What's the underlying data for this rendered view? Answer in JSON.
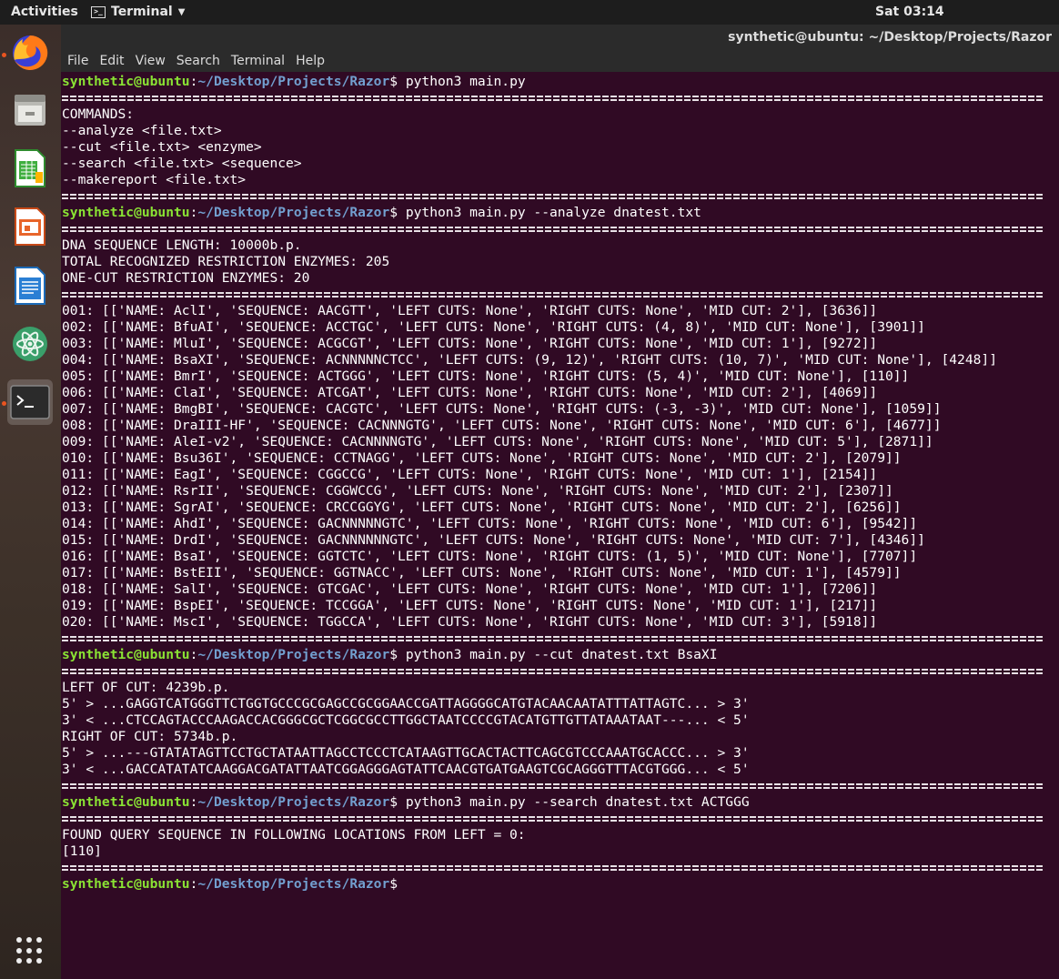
{
  "topbar": {
    "activities": "Activities",
    "app_name": "Terminal",
    "clock": "Sat 03:14"
  },
  "window": {
    "title": "synthetic@ubuntu: ~/Desktop/Projects/Razor"
  },
  "menu": [
    "File",
    "Edit",
    "View",
    "Search",
    "Terminal",
    "Help"
  ],
  "prompt": {
    "user": "synthetic@ubuntu",
    "colon": ":",
    "path": "~/Desktop/Projects/Razor",
    "dollar": "$"
  },
  "dock": {
    "items": [
      "firefox-icon",
      "files-icon",
      "calc-icon",
      "impress-icon",
      "writer-icon",
      "atom-icon",
      "terminal-icon",
      "app-grid-icon"
    ]
  },
  "terminal": {
    "lines": [
      {
        "type": "prompt",
        "cmd": " python3 main.py"
      },
      {
        "type": "sep"
      },
      {
        "type": "out",
        "text": "COMMANDS:"
      },
      {
        "type": "out",
        "text": "--analyze <file.txt>"
      },
      {
        "type": "out",
        "text": "--cut <file.txt> <enzyme>"
      },
      {
        "type": "out",
        "text": "--search <file.txt> <sequence>"
      },
      {
        "type": "out",
        "text": "--makereport <file.txt>"
      },
      {
        "type": "sep"
      },
      {
        "type": "prompt",
        "cmd": " python3 main.py --analyze dnatest.txt"
      },
      {
        "type": "sep"
      },
      {
        "type": "out",
        "text": "DNA SEQUENCE LENGTH: 10000b.p."
      },
      {
        "type": "out",
        "text": "TOTAL RECOGNIZED RESTRICTION ENZYMES: 205"
      },
      {
        "type": "out",
        "text": "ONE-CUT RESTRICTION ENZYMES: 20"
      },
      {
        "type": "sep"
      },
      {
        "type": "out",
        "text": "001: [['NAME: AclI', 'SEQUENCE: AACGTT', 'LEFT CUTS: None', 'RIGHT CUTS: None', 'MID CUT: 2'], [3636]]"
      },
      {
        "type": "out",
        "text": "002: [['NAME: BfuAI', 'SEQUENCE: ACCTGC', 'LEFT CUTS: None', 'RIGHT CUTS: (4, 8)', 'MID CUT: None'], [3901]]"
      },
      {
        "type": "out",
        "text": "003: [['NAME: MluI', 'SEQUENCE: ACGCGT', 'LEFT CUTS: None', 'RIGHT CUTS: None', 'MID CUT: 1'], [9272]]"
      },
      {
        "type": "out",
        "text": "004: [['NAME: BsaXI', 'SEQUENCE: ACNNNNNCTCC', 'LEFT CUTS: (9, 12)', 'RIGHT CUTS: (10, 7)', 'MID CUT: None'], [4248]]"
      },
      {
        "type": "out",
        "text": "005: [['NAME: BmrI', 'SEQUENCE: ACTGGG', 'LEFT CUTS: None', 'RIGHT CUTS: (5, 4)', 'MID CUT: None'], [110]]"
      },
      {
        "type": "out",
        "text": "006: [['NAME: ClaI', 'SEQUENCE: ATCGAT', 'LEFT CUTS: None', 'RIGHT CUTS: None', 'MID CUT: 2'], [4069]]"
      },
      {
        "type": "out",
        "text": "007: [['NAME: BmgBI', 'SEQUENCE: CACGTC', 'LEFT CUTS: None', 'RIGHT CUTS: (-3, -3)', 'MID CUT: None'], [1059]]"
      },
      {
        "type": "out",
        "text": "008: [['NAME: DraIII-HF', 'SEQUENCE: CACNNNGTG', 'LEFT CUTS: None', 'RIGHT CUTS: None', 'MID CUT: 6'], [4677]]"
      },
      {
        "type": "out",
        "text": "009: [['NAME: AleI-v2', 'SEQUENCE: CACNNNNGTG', 'LEFT CUTS: None', 'RIGHT CUTS: None', 'MID CUT: 5'], [2871]]"
      },
      {
        "type": "out",
        "text": "010: [['NAME: Bsu36I', 'SEQUENCE: CCTNAGG', 'LEFT CUTS: None', 'RIGHT CUTS: None', 'MID CUT: 2'], [2079]]"
      },
      {
        "type": "out",
        "text": "011: [['NAME: EagI', 'SEQUENCE: CGGCCG', 'LEFT CUTS: None', 'RIGHT CUTS: None', 'MID CUT: 1'], [2154]]"
      },
      {
        "type": "out",
        "text": "012: [['NAME: RsrII', 'SEQUENCE: CGGWCCG', 'LEFT CUTS: None', 'RIGHT CUTS: None', 'MID CUT: 2'], [2307]]"
      },
      {
        "type": "out",
        "text": "013: [['NAME: SgrAI', 'SEQUENCE: CRCCGGYG', 'LEFT CUTS: None', 'RIGHT CUTS: None', 'MID CUT: 2'], [6256]]"
      },
      {
        "type": "out",
        "text": "014: [['NAME: AhdI', 'SEQUENCE: GACNNNNNGTC', 'LEFT CUTS: None', 'RIGHT CUTS: None', 'MID CUT: 6'], [9542]]"
      },
      {
        "type": "out",
        "text": "015: [['NAME: DrdI', 'SEQUENCE: GACNNNNNNGTC', 'LEFT CUTS: None', 'RIGHT CUTS: None', 'MID CUT: 7'], [4346]]"
      },
      {
        "type": "out",
        "text": "016: [['NAME: BsaI', 'SEQUENCE: GGTCTC', 'LEFT CUTS: None', 'RIGHT CUTS: (1, 5)', 'MID CUT: None'], [7707]]"
      },
      {
        "type": "out",
        "text": "017: [['NAME: BstEII', 'SEQUENCE: GGTNACC', 'LEFT CUTS: None', 'RIGHT CUTS: None', 'MID CUT: 1'], [4579]]"
      },
      {
        "type": "out",
        "text": "018: [['NAME: SalI', 'SEQUENCE: GTCGAC', 'LEFT CUTS: None', 'RIGHT CUTS: None', 'MID CUT: 1'], [7206]]"
      },
      {
        "type": "out",
        "text": "019: [['NAME: BspEI', 'SEQUENCE: TCCGGA', 'LEFT CUTS: None', 'RIGHT CUTS: None', 'MID CUT: 1'], [217]]"
      },
      {
        "type": "out",
        "text": "020: [['NAME: MscI', 'SEQUENCE: TGGCCA', 'LEFT CUTS: None', 'RIGHT CUTS: None', 'MID CUT: 3'], [5918]]"
      },
      {
        "type": "sep"
      },
      {
        "type": "prompt",
        "cmd": " python3 main.py --cut dnatest.txt BsaXI"
      },
      {
        "type": "sep"
      },
      {
        "type": "out",
        "text": "LEFT OF CUT: 4239b.p."
      },
      {
        "type": "out",
        "text": "5' > ...GAGGTCATGGGTTCTGGTGCCCGCGAGCCGCGGAACCGATTAGGGGCATGTACAACAATATTTATTAGTC... > 3'"
      },
      {
        "type": "out",
        "text": "3' < ...CTCCAGTACCCAAGACCACGGGCGCTCGGCGCCTTGGCTAATCCCCGTACATGTTGTTATAAATAAT---... < 5'"
      },
      {
        "type": "out",
        "text": "RIGHT OF CUT: 5734b.p."
      },
      {
        "type": "out",
        "text": "5' > ...---GTATATAGTTCCTGCTATAATTAGCCTCCCTCATAAGTTGCACTACTTCAGCGTCCCAAATGCACCC... > 3'"
      },
      {
        "type": "out",
        "text": "3' < ...GACCATATATCAAGGACGATATTAATCGGAGGGAGTATTCAACGTGATGAAGTCGCAGGGTTTACGTGGG... < 5'"
      },
      {
        "type": "sep"
      },
      {
        "type": "prompt",
        "cmd": " python3 main.py --search dnatest.txt ACTGGG"
      },
      {
        "type": "sep"
      },
      {
        "type": "out",
        "text": "FOUND QUERY SEQUENCE IN FOLLOWING LOCATIONS FROM LEFT = 0:"
      },
      {
        "type": "out",
        "text": "[110]"
      },
      {
        "type": "sep"
      },
      {
        "type": "prompt",
        "cmd": ""
      }
    ]
  }
}
